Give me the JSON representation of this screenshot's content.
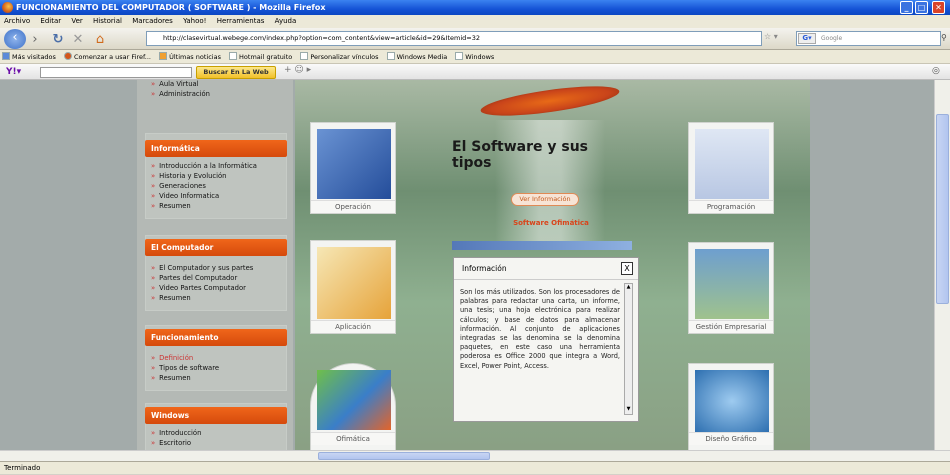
{
  "window": {
    "title": "FUNCIONAMIENTO DEL COMPUTADOR ( SOFTWARE ) - Mozilla Firefox"
  },
  "menu": [
    "Archivo",
    "Editar",
    "Ver",
    "Historial",
    "Marcadores",
    "Yahoo!",
    "Herramientas",
    "Ayuda"
  ],
  "nav": {
    "url": "http://clasevirtual.webege.com/index.php?option=com_content&view=article&id=29&Itemid=32",
    "search_placeholder": "Google"
  },
  "bookmarks": [
    "Más visitados",
    "Comenzar a usar Firef...",
    "Últimas noticias",
    "Hotmail gratuito",
    "Personalizar vínculos",
    "Windows Media",
    "Windows"
  ],
  "yahoo_toolbar": {
    "button": "Buscar En La Web"
  },
  "sidebar": {
    "top_links": [
      "Aula Virtual",
      "Administración"
    ],
    "sections": [
      {
        "title": "Informática",
        "links": [
          "Introducción a la Informática",
          "Historia y Evolución",
          "Generaciones",
          "Video Informatica",
          "Resumen"
        ]
      },
      {
        "title": "El Computador",
        "links": [
          "El Computador y sus partes",
          "Partes del Computador",
          "Video Partes Computador",
          "Resumen"
        ]
      },
      {
        "title": "Funcionamiento",
        "links": [
          "Definición",
          "Tipos de software",
          "Resumen"
        ]
      },
      {
        "title": "Windows",
        "links": [
          "Introducción",
          "Escritorio"
        ]
      }
    ]
  },
  "main": {
    "title": "El Software y sus tipos",
    "more_button": "Ver Información",
    "subtitle": "Software Ofimática",
    "cards": [
      "Operación",
      "Programación",
      "Aplicación",
      "Gestión Empresarial",
      "Ofimática",
      "Diseño Gráfico"
    ]
  },
  "popup": {
    "title": "Información",
    "close": "X",
    "text": "Son los más utilizados. Son los procesadores de palabras para redactar una carta, un informe, una tesis; una hoja electrónica para realizar cálculos; y base de datos para almacenar información. Al conjunto de aplicaciones integradas se las denomina se la denomina paquetes, en este caso una herramienta poderosa es Office 2000 que integra a Word, Excel, Power Point, Access."
  },
  "status": "Terminado"
}
